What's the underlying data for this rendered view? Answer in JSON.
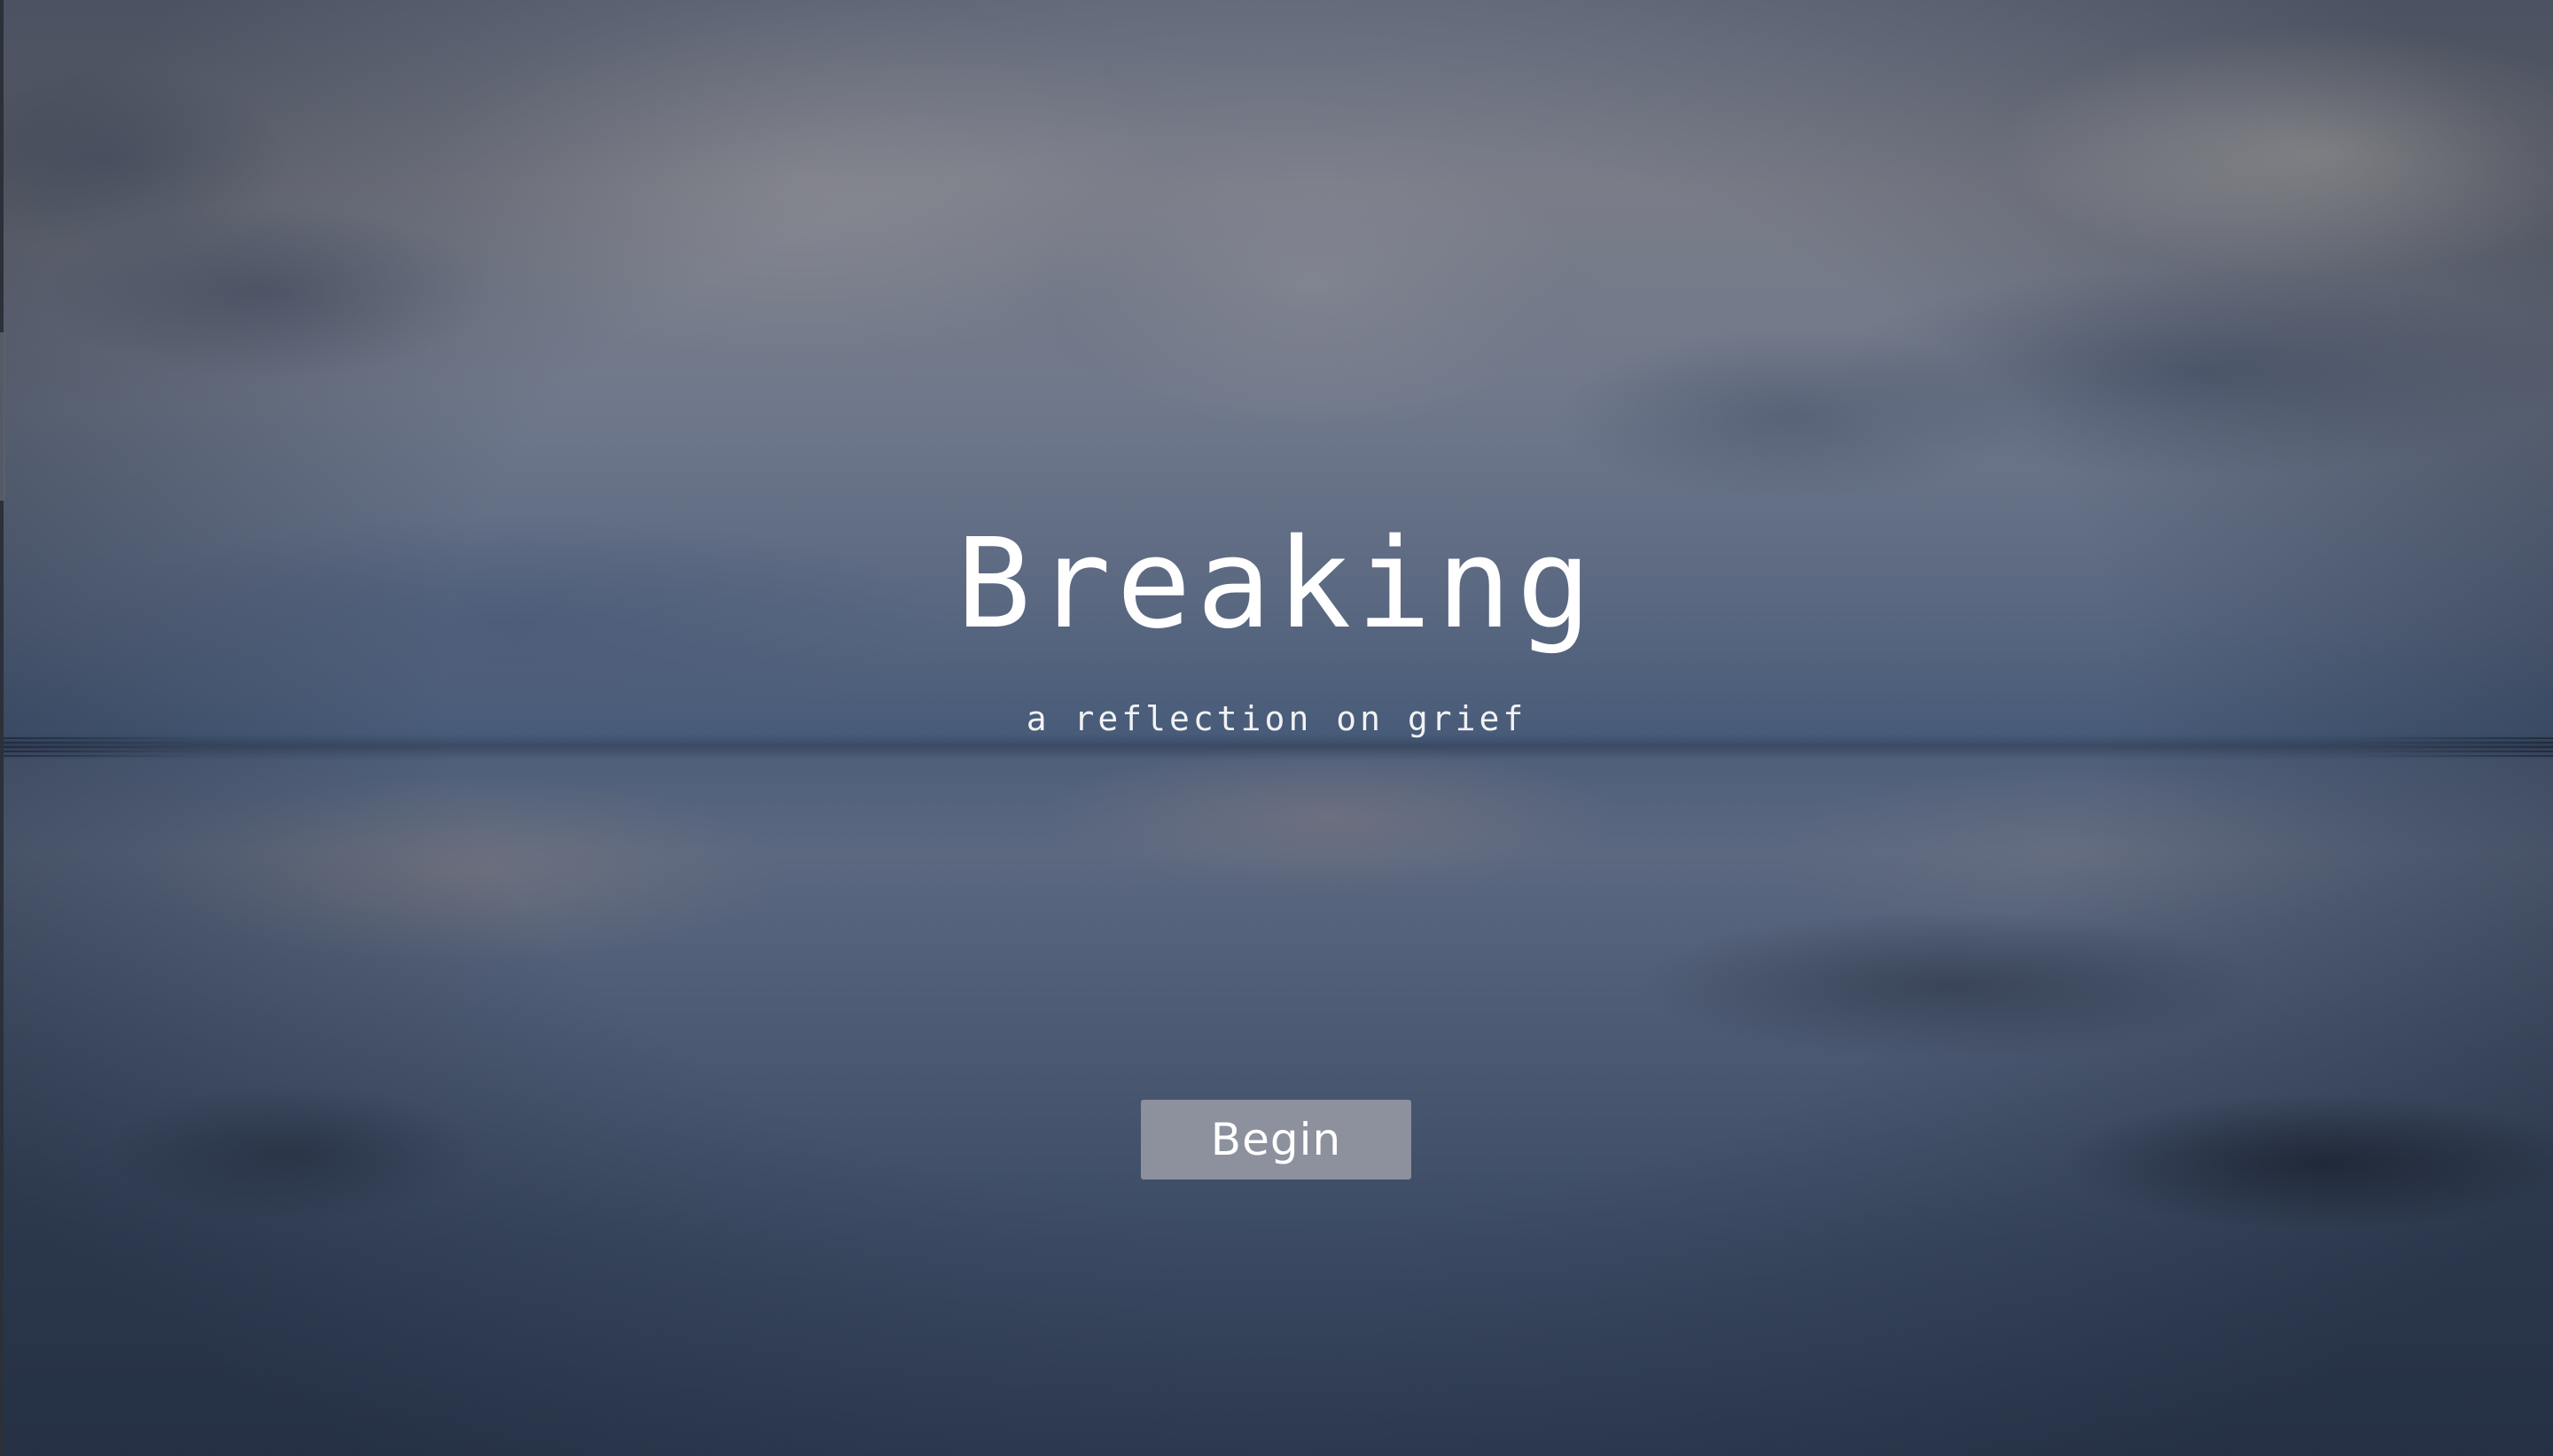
{
  "page": {
    "title": "Breaking",
    "subtitle": "a reflection on grief",
    "begin_label": "Begin"
  },
  "background": {
    "description_icon": "sky-reflection-background",
    "colors": {
      "sky_top": "#6f7687",
      "horizon": "#465a78",
      "water_bottom": "#34425b",
      "button": "#8c919d",
      "text": "#ffffff"
    }
  }
}
